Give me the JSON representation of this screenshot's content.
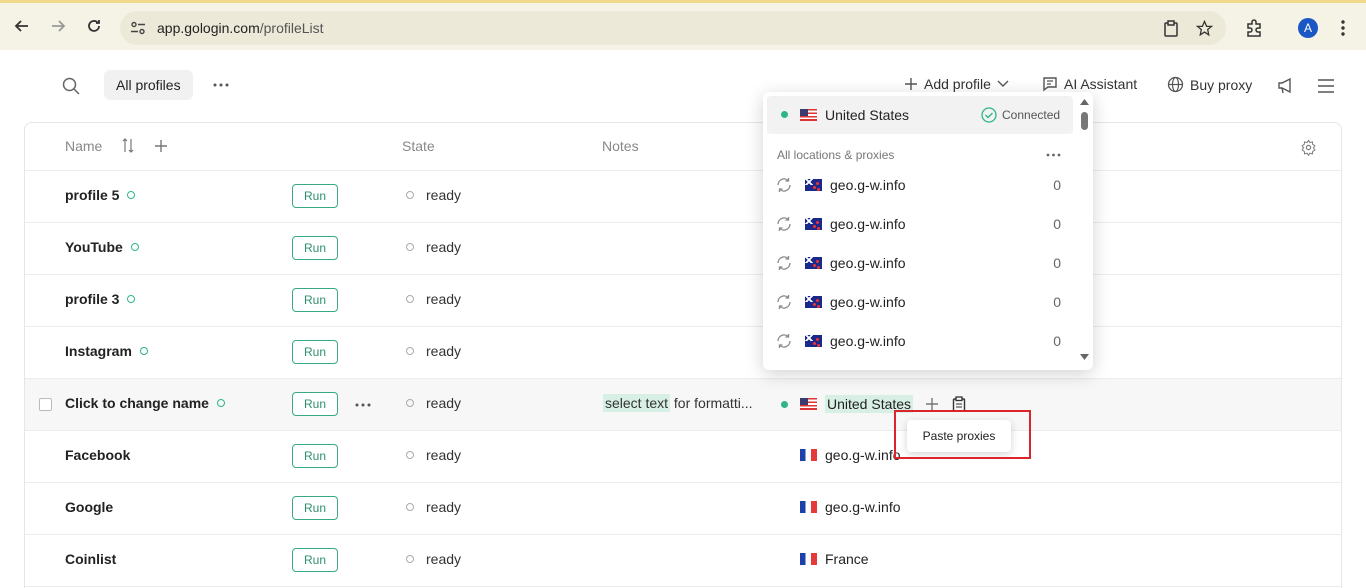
{
  "browser": {
    "url_host": "app.gologin.com",
    "url_path": "/profileList",
    "avatar_letter": "A"
  },
  "toolbar": {
    "tab_label": "All profiles",
    "add_profile": "Add profile",
    "ai_assistant": "AI Assistant",
    "buy_proxy": "Buy proxy"
  },
  "table": {
    "headers": {
      "name": "Name",
      "state": "State",
      "notes": "Notes"
    },
    "rows": [
      {
        "name": "profile 5",
        "run": "Run",
        "state": "ready"
      },
      {
        "name": "YouTube",
        "run": "Run",
        "state": "ready"
      },
      {
        "name": "profile 3",
        "run": "Run",
        "state": "ready"
      },
      {
        "name": "Instagram",
        "run": "Run",
        "state": "ready"
      },
      {
        "name": "Click to change name",
        "run": "Run",
        "state": "ready",
        "note_highlight": "select text",
        "note_rest": "for formatti...",
        "proxy": "United States"
      },
      {
        "name": "Facebook",
        "run": "Run",
        "state": "ready",
        "proxy": "geo.g-w.info"
      },
      {
        "name": "Google",
        "run": "Run",
        "state": "ready",
        "proxy": "geo.g-w.info"
      },
      {
        "name": "Coinlist",
        "run": "Run",
        "state": "ready",
        "proxy": "France"
      }
    ]
  },
  "dropdown": {
    "selected": "United States",
    "status": "Connected",
    "section_label": "All locations & proxies",
    "items": [
      {
        "host": "geo.g-w.info",
        "count": "0"
      },
      {
        "host": "geo.g-w.info",
        "count": "0"
      },
      {
        "host": "geo.g-w.info",
        "count": "0"
      },
      {
        "host": "geo.g-w.info",
        "count": "0"
      },
      {
        "host": "geo.g-w.info",
        "count": "0"
      }
    ]
  },
  "popover": {
    "paste_label": "Paste proxies"
  },
  "colors": {
    "accent": "#2fb58a",
    "highlight_frame": "#d9252b"
  }
}
